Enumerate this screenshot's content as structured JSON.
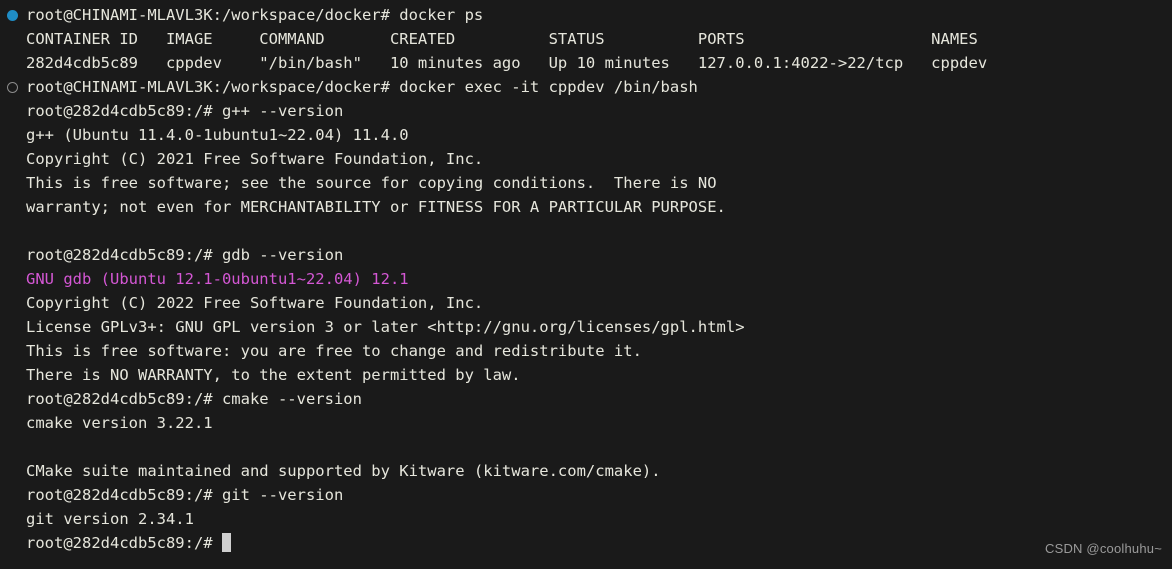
{
  "terminal": {
    "background_color": "#1a1a1a",
    "foreground_color": "#e6e6dc",
    "magenta_color": "#d457d4",
    "cursor_color": "#cfcfcf",
    "decoration_success_color": "#1f8cc4",
    "decoration_neutral_color": "#8b8b8b",
    "lines": [
      {
        "text": "root@CHINAMI-MLAVL3K:/workspace/docker# docker ps",
        "color": "default",
        "decoration": "success"
      },
      {
        "text": "CONTAINER ID   IMAGE     COMMAND       CREATED          STATUS          PORTS                    NAMES",
        "color": "default",
        "decoration": "none"
      },
      {
        "text": "282d4cdb5c89   cppdev    \"/bin/bash\"   10 minutes ago   Up 10 minutes   127.0.0.1:4022->22/tcp   cppdev",
        "color": "default",
        "decoration": "none"
      },
      {
        "text": "root@CHINAMI-MLAVL3K:/workspace/docker# docker exec -it cppdev /bin/bash",
        "color": "default",
        "decoration": "neutral"
      },
      {
        "text": "root@282d4cdb5c89:/# g++ --version",
        "color": "default",
        "decoration": "none"
      },
      {
        "text": "g++ (Ubuntu 11.4.0-1ubuntu1~22.04) 11.4.0",
        "color": "default",
        "decoration": "none"
      },
      {
        "text": "Copyright (C) 2021 Free Software Foundation, Inc.",
        "color": "default",
        "decoration": "none"
      },
      {
        "text": "This is free software; see the source for copying conditions.  There is NO",
        "color": "default",
        "decoration": "none"
      },
      {
        "text": "warranty; not even for MERCHANTABILITY or FITNESS FOR A PARTICULAR PURPOSE.",
        "color": "default",
        "decoration": "none"
      },
      {
        "text": "",
        "color": "default",
        "decoration": "none"
      },
      {
        "text": "root@282d4cdb5c89:/# gdb --version",
        "color": "default",
        "decoration": "none"
      },
      {
        "text": "GNU gdb (Ubuntu 12.1-0ubuntu1~22.04) 12.1",
        "color": "magenta",
        "decoration": "none"
      },
      {
        "text": "Copyright (C) 2022 Free Software Foundation, Inc.",
        "color": "default",
        "decoration": "none"
      },
      {
        "text": "License GPLv3+: GNU GPL version 3 or later <http://gnu.org/licenses/gpl.html>",
        "color": "default",
        "decoration": "none"
      },
      {
        "text": "This is free software: you are free to change and redistribute it.",
        "color": "default",
        "decoration": "none"
      },
      {
        "text": "There is NO WARRANTY, to the extent permitted by law.",
        "color": "default",
        "decoration": "none"
      },
      {
        "text": "root@282d4cdb5c89:/# cmake --version",
        "color": "default",
        "decoration": "none"
      },
      {
        "text": "cmake version 3.22.1",
        "color": "default",
        "decoration": "none"
      },
      {
        "text": "",
        "color": "default",
        "decoration": "none"
      },
      {
        "text": "CMake suite maintained and supported by Kitware (kitware.com/cmake).",
        "color": "default",
        "decoration": "none"
      },
      {
        "text": "root@282d4cdb5c89:/# git --version",
        "color": "default",
        "decoration": "none"
      },
      {
        "text": "git version 2.34.1",
        "color": "default",
        "decoration": "none"
      },
      {
        "text": "root@282d4cdb5c89:/# ",
        "color": "default",
        "decoration": "none",
        "cursor": true
      }
    ]
  },
  "watermark": {
    "text": "CSDN @coolhuhu~"
  }
}
